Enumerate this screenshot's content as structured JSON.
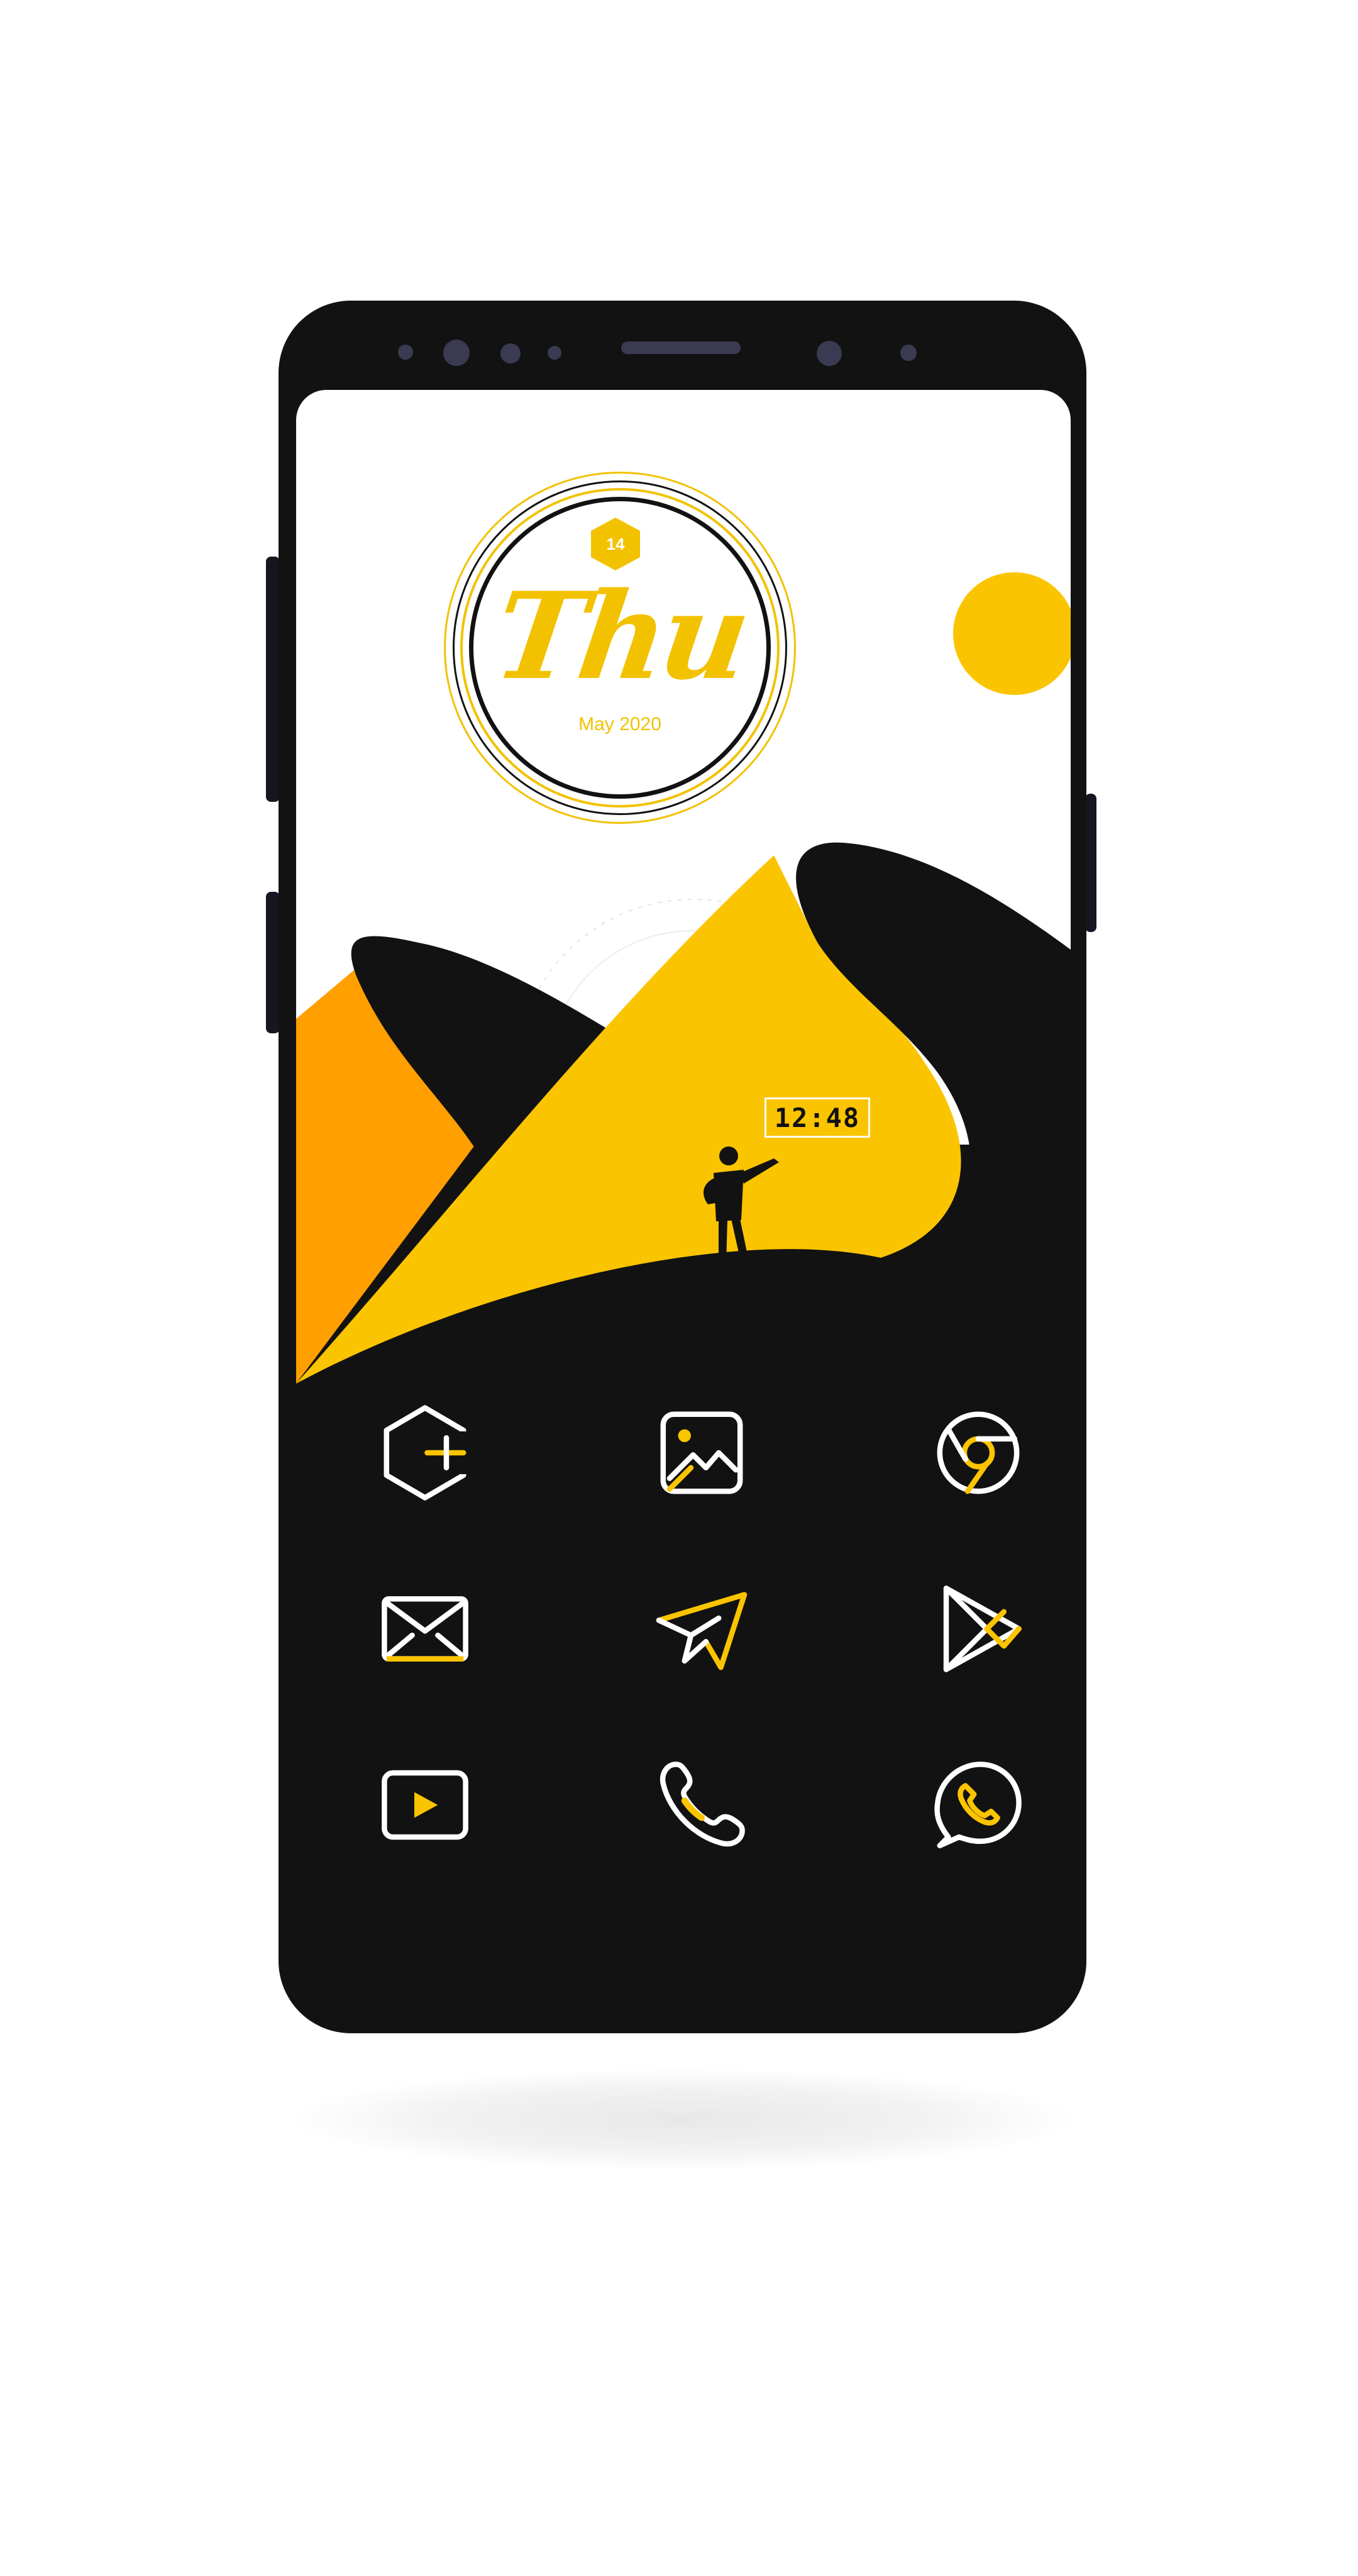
{
  "widgets": {
    "date": {
      "day_number": "14",
      "weekday": "Thu",
      "month_year": "May 2020"
    },
    "clock": {
      "time": "12:48"
    }
  },
  "home_screen": {
    "apps": [
      {
        "name": "settings",
        "icon": "hexagon-settings-icon"
      },
      {
        "name": "gallery",
        "icon": "gallery-icon"
      },
      {
        "name": "chrome",
        "icon": "chrome-icon"
      },
      {
        "name": "email",
        "icon": "mail-icon"
      },
      {
        "name": "telegram",
        "icon": "paper-plane-icon"
      },
      {
        "name": "play-store",
        "icon": "play-store-icon"
      },
      {
        "name": "youtube",
        "icon": "youtube-icon"
      },
      {
        "name": "phone",
        "icon": "phone-icon"
      },
      {
        "name": "whatsapp",
        "icon": "whatsapp-icon"
      }
    ]
  },
  "colors": {
    "accent": "#fbc400",
    "accent_dark": "#ff9f00",
    "dark": "#121212",
    "icon_line": "#ffffff"
  }
}
